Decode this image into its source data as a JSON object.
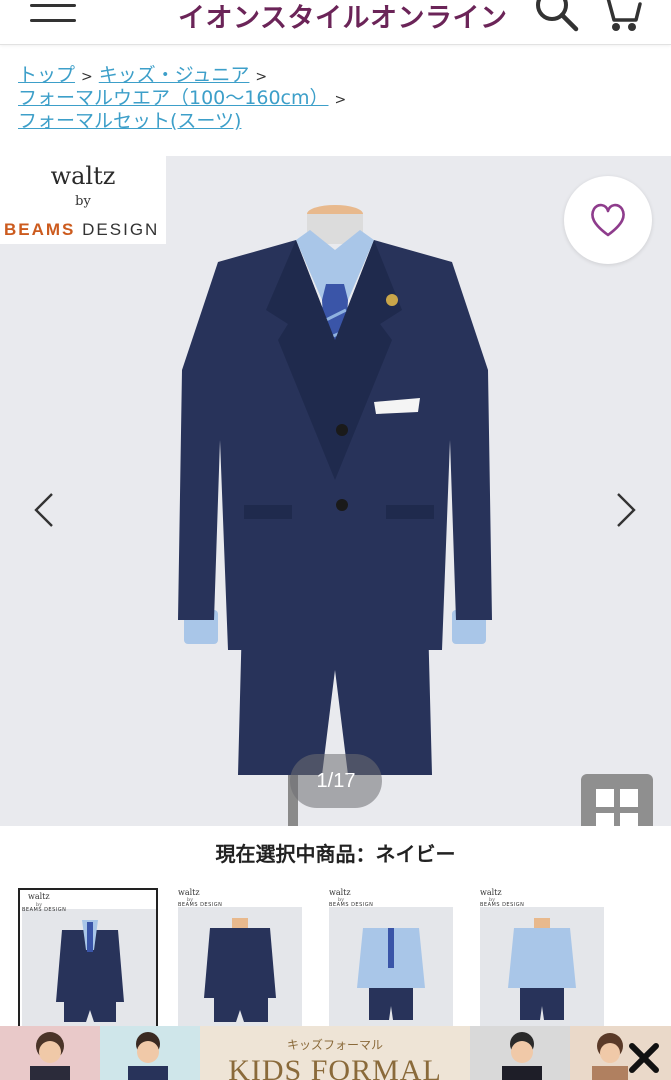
{
  "header": {
    "title": "イオンスタイルオンライン",
    "menu_icon": "hamburger-menu-icon",
    "search_icon": "search-icon",
    "cart_icon": "cart-icon"
  },
  "breadcrumb": [
    {
      "label": "トップ"
    },
    {
      "label": "キッズ・ジュニア"
    },
    {
      "label": "フォーマルウエア（100〜160cm）"
    },
    {
      "label": "フォーマルセット(スーツ)"
    }
  ],
  "breadcrumb_separator": ">",
  "brand": {
    "name": "waltz",
    "by": "by",
    "beams": "BEAMS",
    "design": "DESIGN"
  },
  "gallery": {
    "counter": "1/17",
    "favorite_icon": "heart-icon",
    "grid_icon": "grid-icon"
  },
  "selected": {
    "label": "現在選択中商品：ネイビー"
  },
  "thumbnails": [
    {
      "brand": "waltz",
      "by": "by",
      "beams": "BEAMS DESIGN",
      "view": "front-jacket"
    },
    {
      "brand": "waltz",
      "by": "by",
      "beams": "BEAMS DESIGN",
      "view": "back-jacket"
    },
    {
      "brand": "waltz",
      "by": "by",
      "beams": "BEAMS DESIGN",
      "view": "front-shirt"
    },
    {
      "brand": "waltz",
      "by": "by",
      "beams": "BEAMS DESIGN",
      "view": "back-shirt"
    }
  ],
  "banner": {
    "sub": "キッズフォーマル",
    "main": "KIDS FORMAL",
    "close_icon": "close-icon"
  },
  "colors": {
    "brand_purple": "#6b2458",
    "link_blue": "#3d9fc9",
    "suit_navy": "#28335a",
    "heart": "#8e3c8c"
  }
}
